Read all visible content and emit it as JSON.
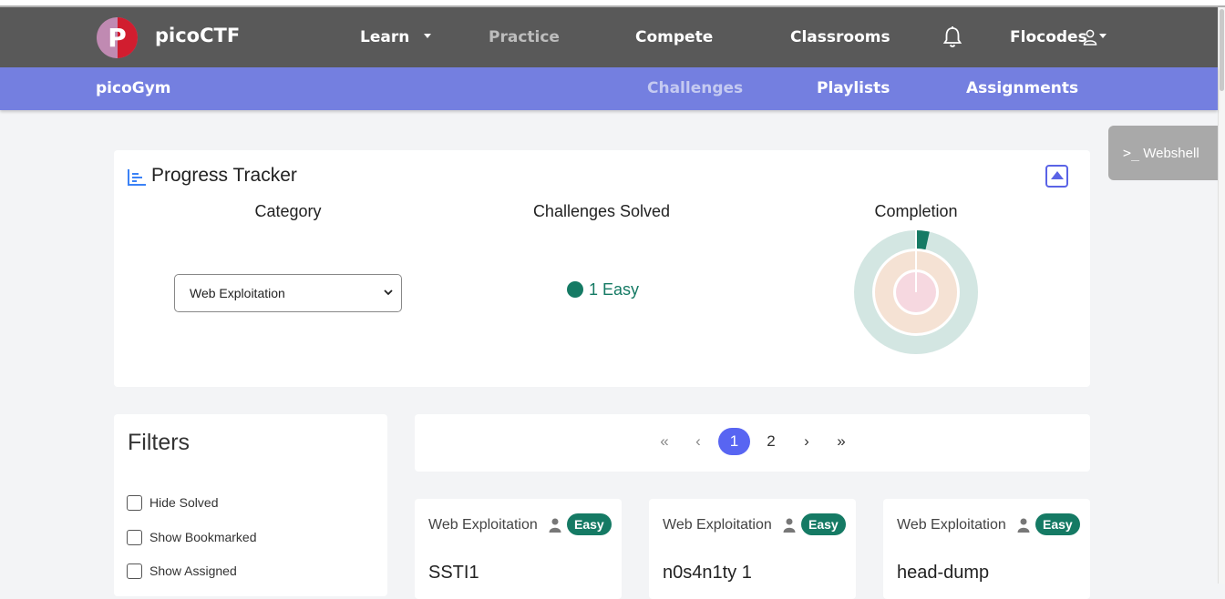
{
  "nav": {
    "logo_letter": "P",
    "brand": "picoCTF",
    "items": [
      "Learn",
      "Practice",
      "Compete",
      "Classrooms"
    ],
    "user": "Flocodes"
  },
  "subnav": {
    "title": "picoGym",
    "items": [
      "Challenges",
      "Playlists",
      "Assignments"
    ]
  },
  "webshell": {
    "label": "Webshell"
  },
  "progress": {
    "title": "Progress Tracker",
    "headers": [
      "Category",
      "Challenges Solved",
      "Completion"
    ],
    "category_selected": "Web Exploitation",
    "solved_text": "1 Easy",
    "completion_fraction": 0.035
  },
  "filters": {
    "title": "Filters",
    "options": [
      "Hide Solved",
      "Show Bookmarked",
      "Show Assigned"
    ]
  },
  "pagination": {
    "first": "«",
    "prev": "‹",
    "pages": [
      "1",
      "2"
    ],
    "active_page": "1",
    "next": "›",
    "last": "»"
  },
  "challenges": [
    {
      "category": "Web Exploitation",
      "difficulty": "Easy",
      "title": "SSTI1"
    },
    {
      "category": "Web Exploitation",
      "difficulty": "Easy",
      "title": "n0s4n1ty 1"
    },
    {
      "category": "Web Exploitation",
      "difficulty": "Easy",
      "title": "head-dump"
    }
  ],
  "colors": {
    "navbar": "#595959",
    "subnav": "#747fe0",
    "accent": "#5865f2",
    "easy": "#157a64"
  }
}
